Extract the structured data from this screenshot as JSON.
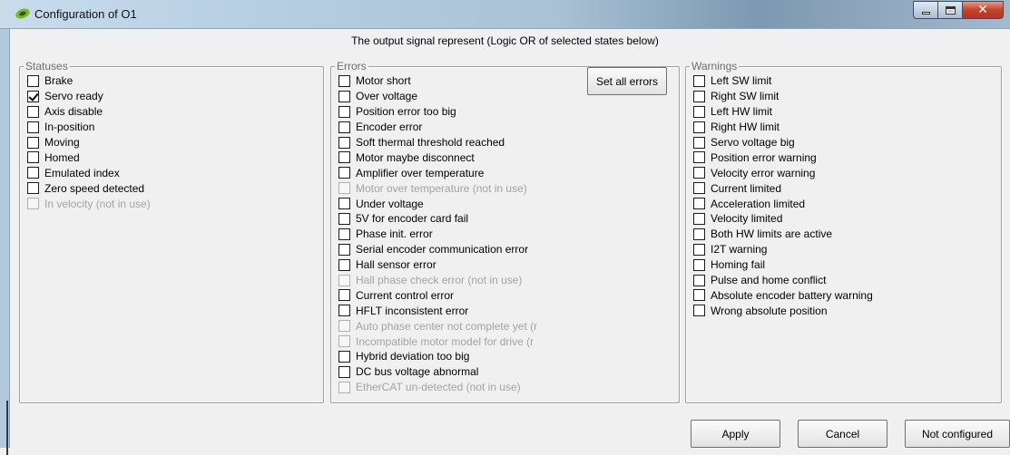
{
  "window": {
    "title": "Configuration of O1"
  },
  "header": {
    "text": "The output signal represent  (Logic OR of selected states below)"
  },
  "statuses": {
    "legend": "Statuses",
    "items": [
      {
        "label": "Brake",
        "checked": false,
        "disabled": false
      },
      {
        "label": "Servo ready",
        "checked": true,
        "disabled": false
      },
      {
        "label": "Axis disable",
        "checked": false,
        "disabled": false
      },
      {
        "label": "In-position",
        "checked": false,
        "disabled": false
      },
      {
        "label": "Moving",
        "checked": false,
        "disabled": false
      },
      {
        "label": "Homed",
        "checked": false,
        "disabled": false
      },
      {
        "label": "Emulated index",
        "checked": false,
        "disabled": false
      },
      {
        "label": "Zero speed detected",
        "checked": false,
        "disabled": false
      },
      {
        "label": "In velocity (not in use)",
        "checked": false,
        "disabled": true
      }
    ]
  },
  "errors": {
    "legend": "Errors",
    "set_all_label": "Set all errors",
    "items": [
      {
        "label": "Motor short",
        "checked": false,
        "disabled": false
      },
      {
        "label": "Over voltage",
        "checked": false,
        "disabled": false
      },
      {
        "label": "Position error too big",
        "checked": false,
        "disabled": false
      },
      {
        "label": "Encoder error",
        "checked": false,
        "disabled": false
      },
      {
        "label": "Soft thermal threshold reached",
        "checked": false,
        "disabled": false
      },
      {
        "label": "Motor maybe disconnect",
        "checked": false,
        "disabled": false
      },
      {
        "label": "Amplifier over temperature",
        "checked": false,
        "disabled": false
      },
      {
        "label": "Motor over temperature (not in use)",
        "checked": false,
        "disabled": true
      },
      {
        "label": "Under voltage",
        "checked": false,
        "disabled": false
      },
      {
        "label": "5V for encoder card fail",
        "checked": false,
        "disabled": false
      },
      {
        "label": "Phase init. error",
        "checked": false,
        "disabled": false
      },
      {
        "label": "Serial encoder communication error",
        "checked": false,
        "disabled": false
      },
      {
        "label": "Hall sensor error",
        "checked": false,
        "disabled": false
      },
      {
        "label": "Hall phase check error (not in use)",
        "checked": false,
        "disabled": true
      },
      {
        "label": "Current control error",
        "checked": false,
        "disabled": false
      },
      {
        "label": "HFLT inconsistent error",
        "checked": false,
        "disabled": false
      },
      {
        "label": "Auto phase center not complete yet (r",
        "checked": false,
        "disabled": true
      },
      {
        "label": "Incompatible motor model for drive (r",
        "checked": false,
        "disabled": true
      },
      {
        "label": "Hybrid deviation too big",
        "checked": false,
        "disabled": false
      },
      {
        "label": "DC bus voltage abnormal",
        "checked": false,
        "disabled": false
      },
      {
        "label": "EtherCAT un-detected (not in use)",
        "checked": false,
        "disabled": true
      }
    ]
  },
  "warnings": {
    "legend": "Warnings",
    "items": [
      {
        "label": "Left SW limit",
        "checked": false,
        "disabled": false
      },
      {
        "label": "Right SW limit",
        "checked": false,
        "disabled": false
      },
      {
        "label": "Left HW limit",
        "checked": false,
        "disabled": false
      },
      {
        "label": "Right HW limit",
        "checked": false,
        "disabled": false
      },
      {
        "label": "Servo voltage big",
        "checked": false,
        "disabled": false
      },
      {
        "label": "Position error warning",
        "checked": false,
        "disabled": false
      },
      {
        "label": "Velocity error warning",
        "checked": false,
        "disabled": false
      },
      {
        "label": "Current limited",
        "checked": false,
        "disabled": false
      },
      {
        "label": "Acceleration limited",
        "checked": false,
        "disabled": false
      },
      {
        "label": "Velocity limited",
        "checked": false,
        "disabled": false
      },
      {
        "label": "Both HW limits are active",
        "checked": false,
        "disabled": false
      },
      {
        "label": "I2T warning",
        "checked": false,
        "disabled": false
      },
      {
        "label": "Homing fail",
        "checked": false,
        "disabled": false
      },
      {
        "label": "Pulse and home conflict",
        "checked": false,
        "disabled": false
      },
      {
        "label": "Absolute encoder battery warning",
        "checked": false,
        "disabled": false
      },
      {
        "label": "Wrong absolute position",
        "checked": false,
        "disabled": false
      }
    ]
  },
  "footer": {
    "apply_label": "Apply",
    "cancel_label": "Cancel",
    "not_configured_label": "Not configured"
  }
}
